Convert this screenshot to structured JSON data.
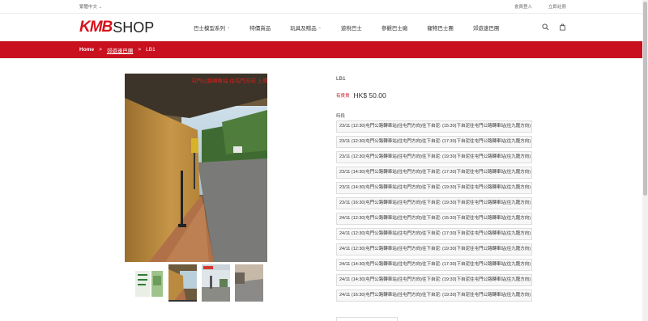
{
  "topbar": {
    "language": "繁體中文",
    "login": "會員登入",
    "register": "立即註冊"
  },
  "header": {
    "logo_kmb": "KMB",
    "logo_shop": "SHOP",
    "nav": [
      {
        "label": "巴士模型系列",
        "has_dropdown": true
      },
      {
        "label": "特價貨品",
        "has_dropdown": false
      },
      {
        "label": "玩具及贈品",
        "has_dropdown": true
      },
      {
        "label": "遊稅巴士",
        "has_dropdown": false
      },
      {
        "label": "參觀巴士廠",
        "has_dropdown": false
      },
      {
        "label": "寵物巴士團",
        "has_dropdown": false
      },
      {
        "label": "郊遊速巴團",
        "has_dropdown": false
      }
    ]
  },
  "breadcrumb": {
    "home": "Home",
    "sep": ">",
    "category": "郊遊速巴團",
    "current": "LB1"
  },
  "product": {
    "name": "LB1",
    "stock": "有貨貨",
    "price": "HK$ 50.00",
    "option_label": "時段",
    "main_image_caption": "屯門公路轉車站 往屯門方向 上車位置",
    "options": [
      "23/11 (12:30)屯門公路轉車站(往屯門方向)往下自泥: (15:30)下自泥往屯門公路轉車站(往九龍方向)",
      "23/11 (12:30)屯門公路轉車站(往屯門方向)往下自泥: (17:30)下自泥往屯門公路轉車站(往九龍方向)",
      "23/11 (12:30)屯門公路轉車站(往屯門方向)往下自泥: (19:30)下自泥往屯門公路轉車站(往九龍方向)",
      "23/11 (14:30)屯門公路轉車站(往屯門方向)往下自泥: (17:30)下自泥往屯門公路轉車站(往九龍方向)",
      "23/11 (14:30)屯門公路轉車站(往屯門方向)往下自泥: (19:30)下自泥往屯門公路轉車站(往九龍方向)",
      "23/11 (16:30)屯門公路轉車站(往屯門方向)往下自泥: (19:30)下自泥往屯門公路轉車站(往九龍方向)",
      "24/11 (12:30)屯門公路轉車站(往屯門方向)往下自泥: (15:30)下自泥往屯門公路轉車站(往九龍方向)",
      "24/11 (12:30)屯門公路轉車站(往屯門方向)往下自泥: (17:30)下自泥往屯門公路轉車站(往九龍方向)",
      "24/11 (12:30)屯門公路轉車站(往屯門方向)往下自泥: (19:30)下自泥往屯門公路轉車站(往九龍方向)",
      "24/11 (14:30)屯門公路轉車站(往屯門方向)往下自泥: (17:30)下自泥往屯門公路轉車站(往九龍方向)",
      "24/11 (14:30)屯門公路轉車站(往屯門方向)往下自泥: (19:30)下自泥往屯門公路轉車站(往九龍方向)",
      "24/11 (16:30)屯門公路轉車站(往屯門方向)往下自泥: (19:30)下自泥往屯門公路轉車站(往九龍方向)"
    ]
  },
  "colors": {
    "brand_red": "#c8101e",
    "logo_red": "#d7121b"
  },
  "icons": {
    "search": "search-icon",
    "cart": "cart-icon",
    "chevron": "chevron-down-icon"
  }
}
